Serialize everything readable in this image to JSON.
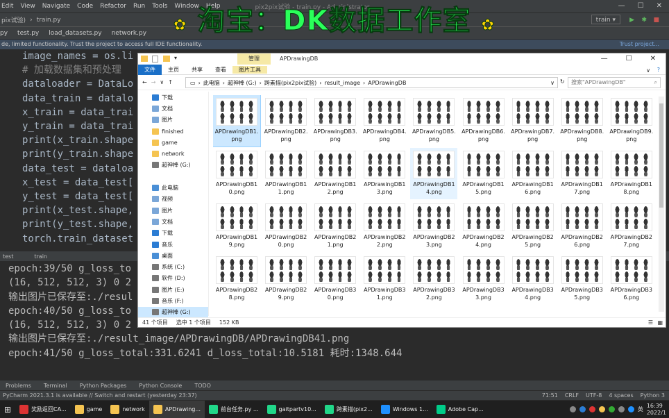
{
  "ide": {
    "menu": [
      "Edit",
      "View",
      "Navigate",
      "Code",
      "Refactor",
      "Run",
      "Tools",
      "Window",
      "Help"
    ],
    "window_title": "pix2pix试验 - train.py - Administrator",
    "nav_crumbs": [
      "pix试验)",
      "train.py"
    ],
    "run_config": "train",
    "tabs": [
      "py",
      "test.py",
      "load_datasets.py",
      "network.py"
    ],
    "warning": "de, limited functionality. Trust the project to access full IDE functionality.",
    "trust_link": "Trust project...",
    "code_lines": [
      "image_names = os.li",
      "# 加载数据集和预处理",
      "dataloader = DataLo",
      "data_train = datalo",
      "x_train = data_trai",
      "y_train = data_trai",
      "print(x_train.shape",
      "print(y_train.shape",
      "data_test = dataloa",
      "x_test = data_test[",
      "y_test = data_test[",
      "print(x_test.shape,",
      "print(y_test.shape,",
      "torch.train_dataset"
    ],
    "run_tabs": [
      "test",
      "train"
    ],
    "console_lines": [
      "epoch:39/50 g_loss_to",
      "(16, 512, 512, 3) 0 2",
      "输出图片已保存至:./resul",
      "epoch:40/50 g_loss_to",
      "(16, 512, 512, 3) 0 2",
      "输出图片已保存至:./result_image/APDrawingDB/APDrawingDB41.png",
      "epoch:41/50 g_loss_total:331.6241 d_loss_total:10.5181 耗时:1348.644"
    ],
    "tool_windows": [
      "Problems",
      "Terminal",
      "Python Packages",
      "Python Console",
      "TODO"
    ],
    "status_left": "PyCharm 2021.3.1 is available // Switch and restart (yesterday 23:37)",
    "status_right": [
      "71:51",
      "CRLF",
      "UTF-8",
      "4 spaces",
      "Python 3"
    ]
  },
  "watermark": "淘宝：DK数据工作室",
  "explorer": {
    "title": "APDrawingDB",
    "manage_tab": "管理",
    "ribbon": [
      "文件",
      "主页",
      "共享",
      "查看",
      "图片工具"
    ],
    "address": [
      "此电脑",
      "超神棒 (G:)",
      "跨素描(pix2pix试验)",
      "result_image",
      "APDrawingDB"
    ],
    "search_placeholder": "搜索\"APDrawingDB\"",
    "nav": [
      {
        "label": "下载",
        "color": "#2b7cd3"
      },
      {
        "label": "文档",
        "color": "#7ba7d8"
      },
      {
        "label": "图片",
        "color": "#7ba7d8"
      },
      {
        "label": "finished",
        "color": "#f5c451"
      },
      {
        "label": "game",
        "color": "#f5c451"
      },
      {
        "label": "network",
        "color": "#f5c451"
      },
      {
        "label": "超神棒 (G:)",
        "color": "#777"
      },
      {
        "label": "",
        "color": "transparent"
      },
      {
        "label": "此电脑",
        "color": "#4a8fd6"
      },
      {
        "label": "视频",
        "color": "#7ba7d8"
      },
      {
        "label": "图片",
        "color": "#7ba7d8"
      },
      {
        "label": "文档",
        "color": "#7ba7d8"
      },
      {
        "label": "下载",
        "color": "#2b7cd3"
      },
      {
        "label": "音乐",
        "color": "#2b7cd3"
      },
      {
        "label": "桌面",
        "color": "#4a8fd6"
      },
      {
        "label": "系统 (C:)",
        "color": "#777"
      },
      {
        "label": "软件 (D:)",
        "color": "#777"
      },
      {
        "label": "图片 (E:)",
        "color": "#777"
      },
      {
        "label": "音乐 (F:)",
        "color": "#777"
      },
      {
        "label": "超神棒 (G:)",
        "color": "#777"
      }
    ],
    "files": [
      "APDrawingDB1.png",
      "APDrawingDB2.png",
      "APDrawingDB3.png",
      "APDrawingDB4.png",
      "APDrawingDB5.png",
      "APDrawingDB6.png",
      "APDrawingDB7.png",
      "APDrawingDB8.png",
      "APDrawingDB9.png",
      "APDrawingDB10.png",
      "APDrawingDB11.png",
      "APDrawingDB12.png",
      "APDrawingDB13.png",
      "APDrawingDB14.png",
      "APDrawingDB15.png",
      "APDrawingDB16.png",
      "APDrawingDB17.png",
      "APDrawingDB18.png",
      "APDrawingDB19.png",
      "APDrawingDB20.png",
      "APDrawingDB21.png",
      "APDrawingDB22.png",
      "APDrawingDB23.png",
      "APDrawingDB24.png",
      "APDrawingDB25.png",
      "APDrawingDB26.png",
      "APDrawingDB27.png",
      "APDrawingDB28.png",
      "APDrawingDB29.png",
      "APDrawingDB30.png",
      "APDrawingDB31.png",
      "APDrawingDB32.png",
      "APDrawingDB33.png",
      "APDrawingDB34.png",
      "APDrawingDB35.png",
      "APDrawingDB36.png"
    ],
    "status": [
      "41 个项目",
      "选中 1 个项目",
      "152 KB"
    ]
  },
  "taskbar": [
    {
      "label": "奖励返回CA...",
      "color": "#d33"
    },
    {
      "label": "game",
      "color": "#f5c451"
    },
    {
      "label": "network",
      "color": "#f5c451"
    },
    {
      "label": "APDrawing...",
      "color": "#f5c451"
    },
    {
      "label": "前台任务.py ...",
      "color": "#21d789"
    },
    {
      "label": "gaitpartv10...",
      "color": "#21d789"
    },
    {
      "label": "跨素描(pix2...",
      "color": "#21d789"
    },
    {
      "label": "Windows 1...",
      "color": "#1e90ff"
    },
    {
      "label": "Adobe Cap...",
      "color": "#0c8"
    }
  ],
  "clock": [
    "16:39",
    "2022/1"
  ],
  "ime": "英"
}
